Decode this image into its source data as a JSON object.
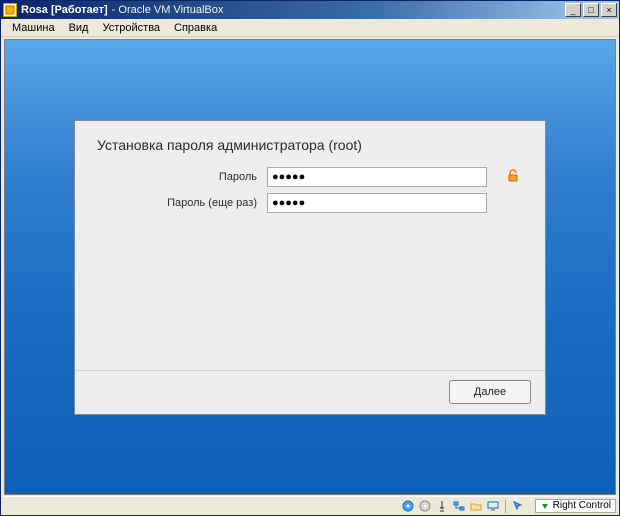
{
  "window": {
    "title_strong": "Rosa [Работает]",
    "title_rest": "- Oracle VM VirtualBox"
  },
  "menubar": {
    "items": [
      "Машина",
      "Вид",
      "Устройства",
      "Справка"
    ]
  },
  "win_controls": {
    "minimize": "_",
    "maximize": "□",
    "close": "×"
  },
  "installer": {
    "title": "Установка пароля администратора (root)",
    "password_label": "Пароль",
    "password_value": "●●●●●",
    "password_repeat_label": "Пароль (еще раз)",
    "password_repeat_value": "●●●●●",
    "next_button": "Далее"
  },
  "statusbar": {
    "host_key": "Right Control"
  },
  "icons": {
    "strength": "unlock-icon"
  }
}
